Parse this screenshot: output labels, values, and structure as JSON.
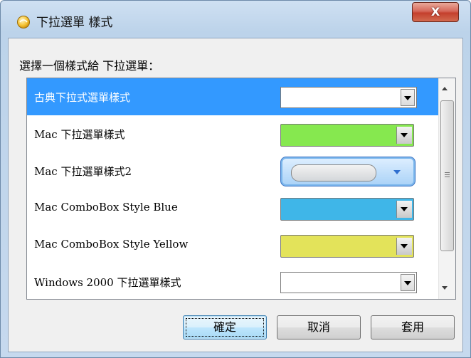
{
  "window": {
    "title": "下拉選單 樣式",
    "close_label": "X"
  },
  "prompt": "選擇一個樣式給 下拉選單：",
  "styles": [
    {
      "label": "古典下拉式選單樣式",
      "selected": true,
      "field_color": "#ffffff",
      "kind": "classic"
    },
    {
      "label": "Mac 下拉選單樣式",
      "selected": false,
      "field_color": "#86e84f",
      "kind": "mac"
    },
    {
      "label": "Mac 下拉選單樣式2",
      "selected": false,
      "field_color": "#d4d7da",
      "kind": "mac2"
    },
    {
      "label": "Mac ComboBox Style Blue",
      "selected": false,
      "field_color": "#3fb6e8",
      "kind": "mac"
    },
    {
      "label": "Mac ComboBox Style Yellow",
      "selected": false,
      "field_color": "#e3e35a",
      "kind": "mac"
    },
    {
      "label": "Windows 2000 下拉選單樣式",
      "selected": false,
      "field_color": "#ffffff",
      "kind": "classic"
    }
  ],
  "buttons": {
    "ok": "確定",
    "cancel": "取消",
    "apply": "套用"
  },
  "colors": {
    "selection": "#3399ff"
  }
}
